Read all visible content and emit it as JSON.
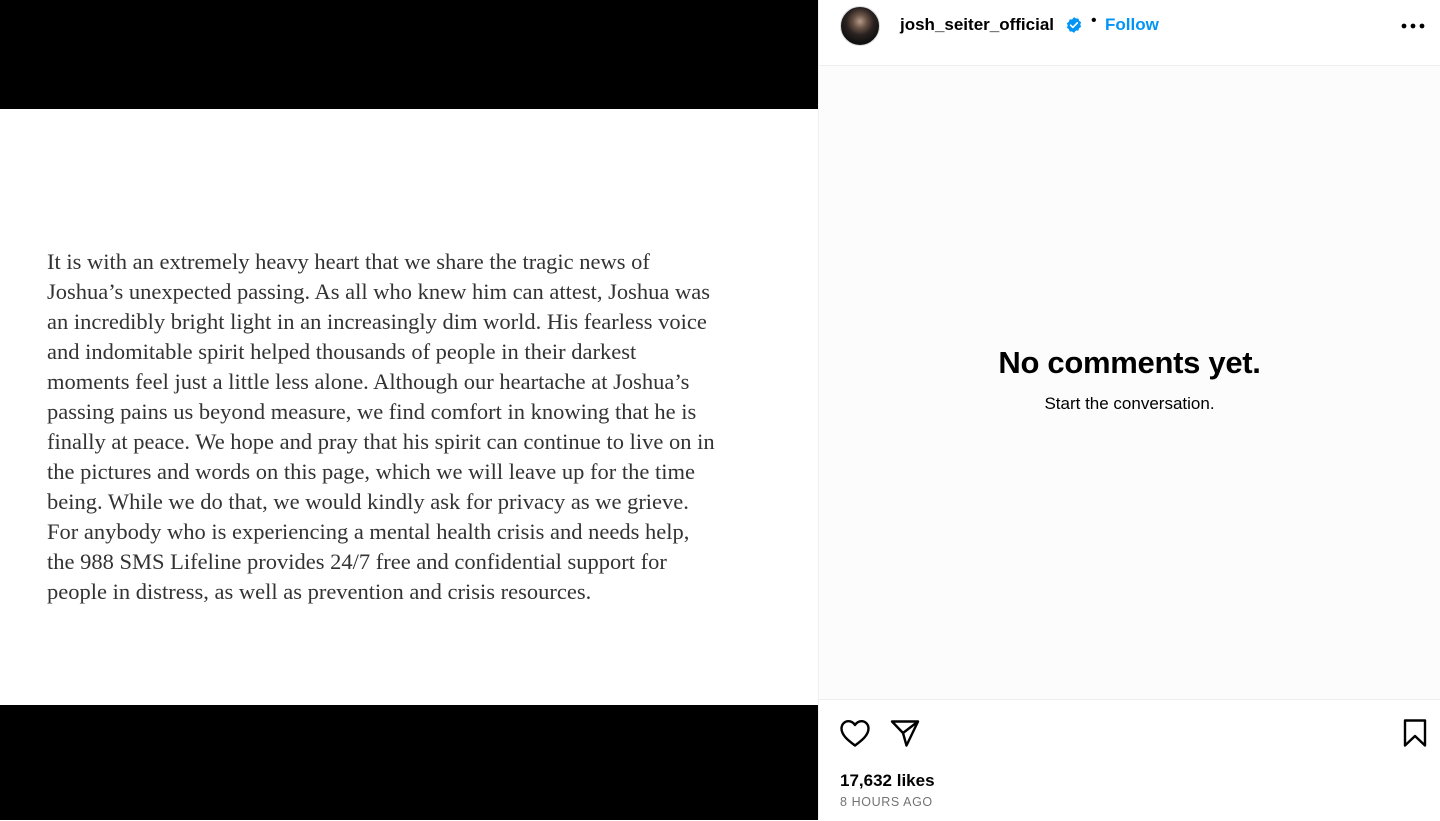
{
  "post": {
    "statement": "It is with an extremely heavy heart that we share the tragic news of\nJoshua’s unexpected passing. As all who knew him can attest, Joshua was\nan incredibly bright light in an increasingly dim world. His fearless voice\nand indomitable spirit helped thousands of people in their darkest\nmoments feel just a little less alone. Although our heartache at Joshua’s\npassing pains us beyond measure, we find comfort in knowing that he is\nfinally at peace. We hope and pray that his spirit can continue to live on in\nthe pictures and words on this page, which we will leave up for the time\nbeing. While we do that, we would kindly ask for privacy as we grieve.\nFor anybody who is experiencing a mental health crisis and needs help,\nthe 988 SMS Lifeline provides 24/7 free and confidential support for\npeople in distress, as well as prevention and crisis resources."
  },
  "header": {
    "username": "josh_seiter_official",
    "separator": "•",
    "follow_label": "Follow",
    "verified": true
  },
  "comments": {
    "empty_title": "No comments yet.",
    "empty_subtitle": "Start the conversation."
  },
  "footer": {
    "likes": "17,632 likes",
    "timestamp": "8 HOURS AGO"
  },
  "icons": {
    "verified": "verified-badge-icon",
    "more": "more-options-icon",
    "like": "heart-icon",
    "share": "paper-plane-icon",
    "save": "bookmark-icon"
  },
  "colors": {
    "accent": "#0095f6",
    "text": "#000000",
    "muted": "#737373",
    "media_background": "#000000"
  }
}
